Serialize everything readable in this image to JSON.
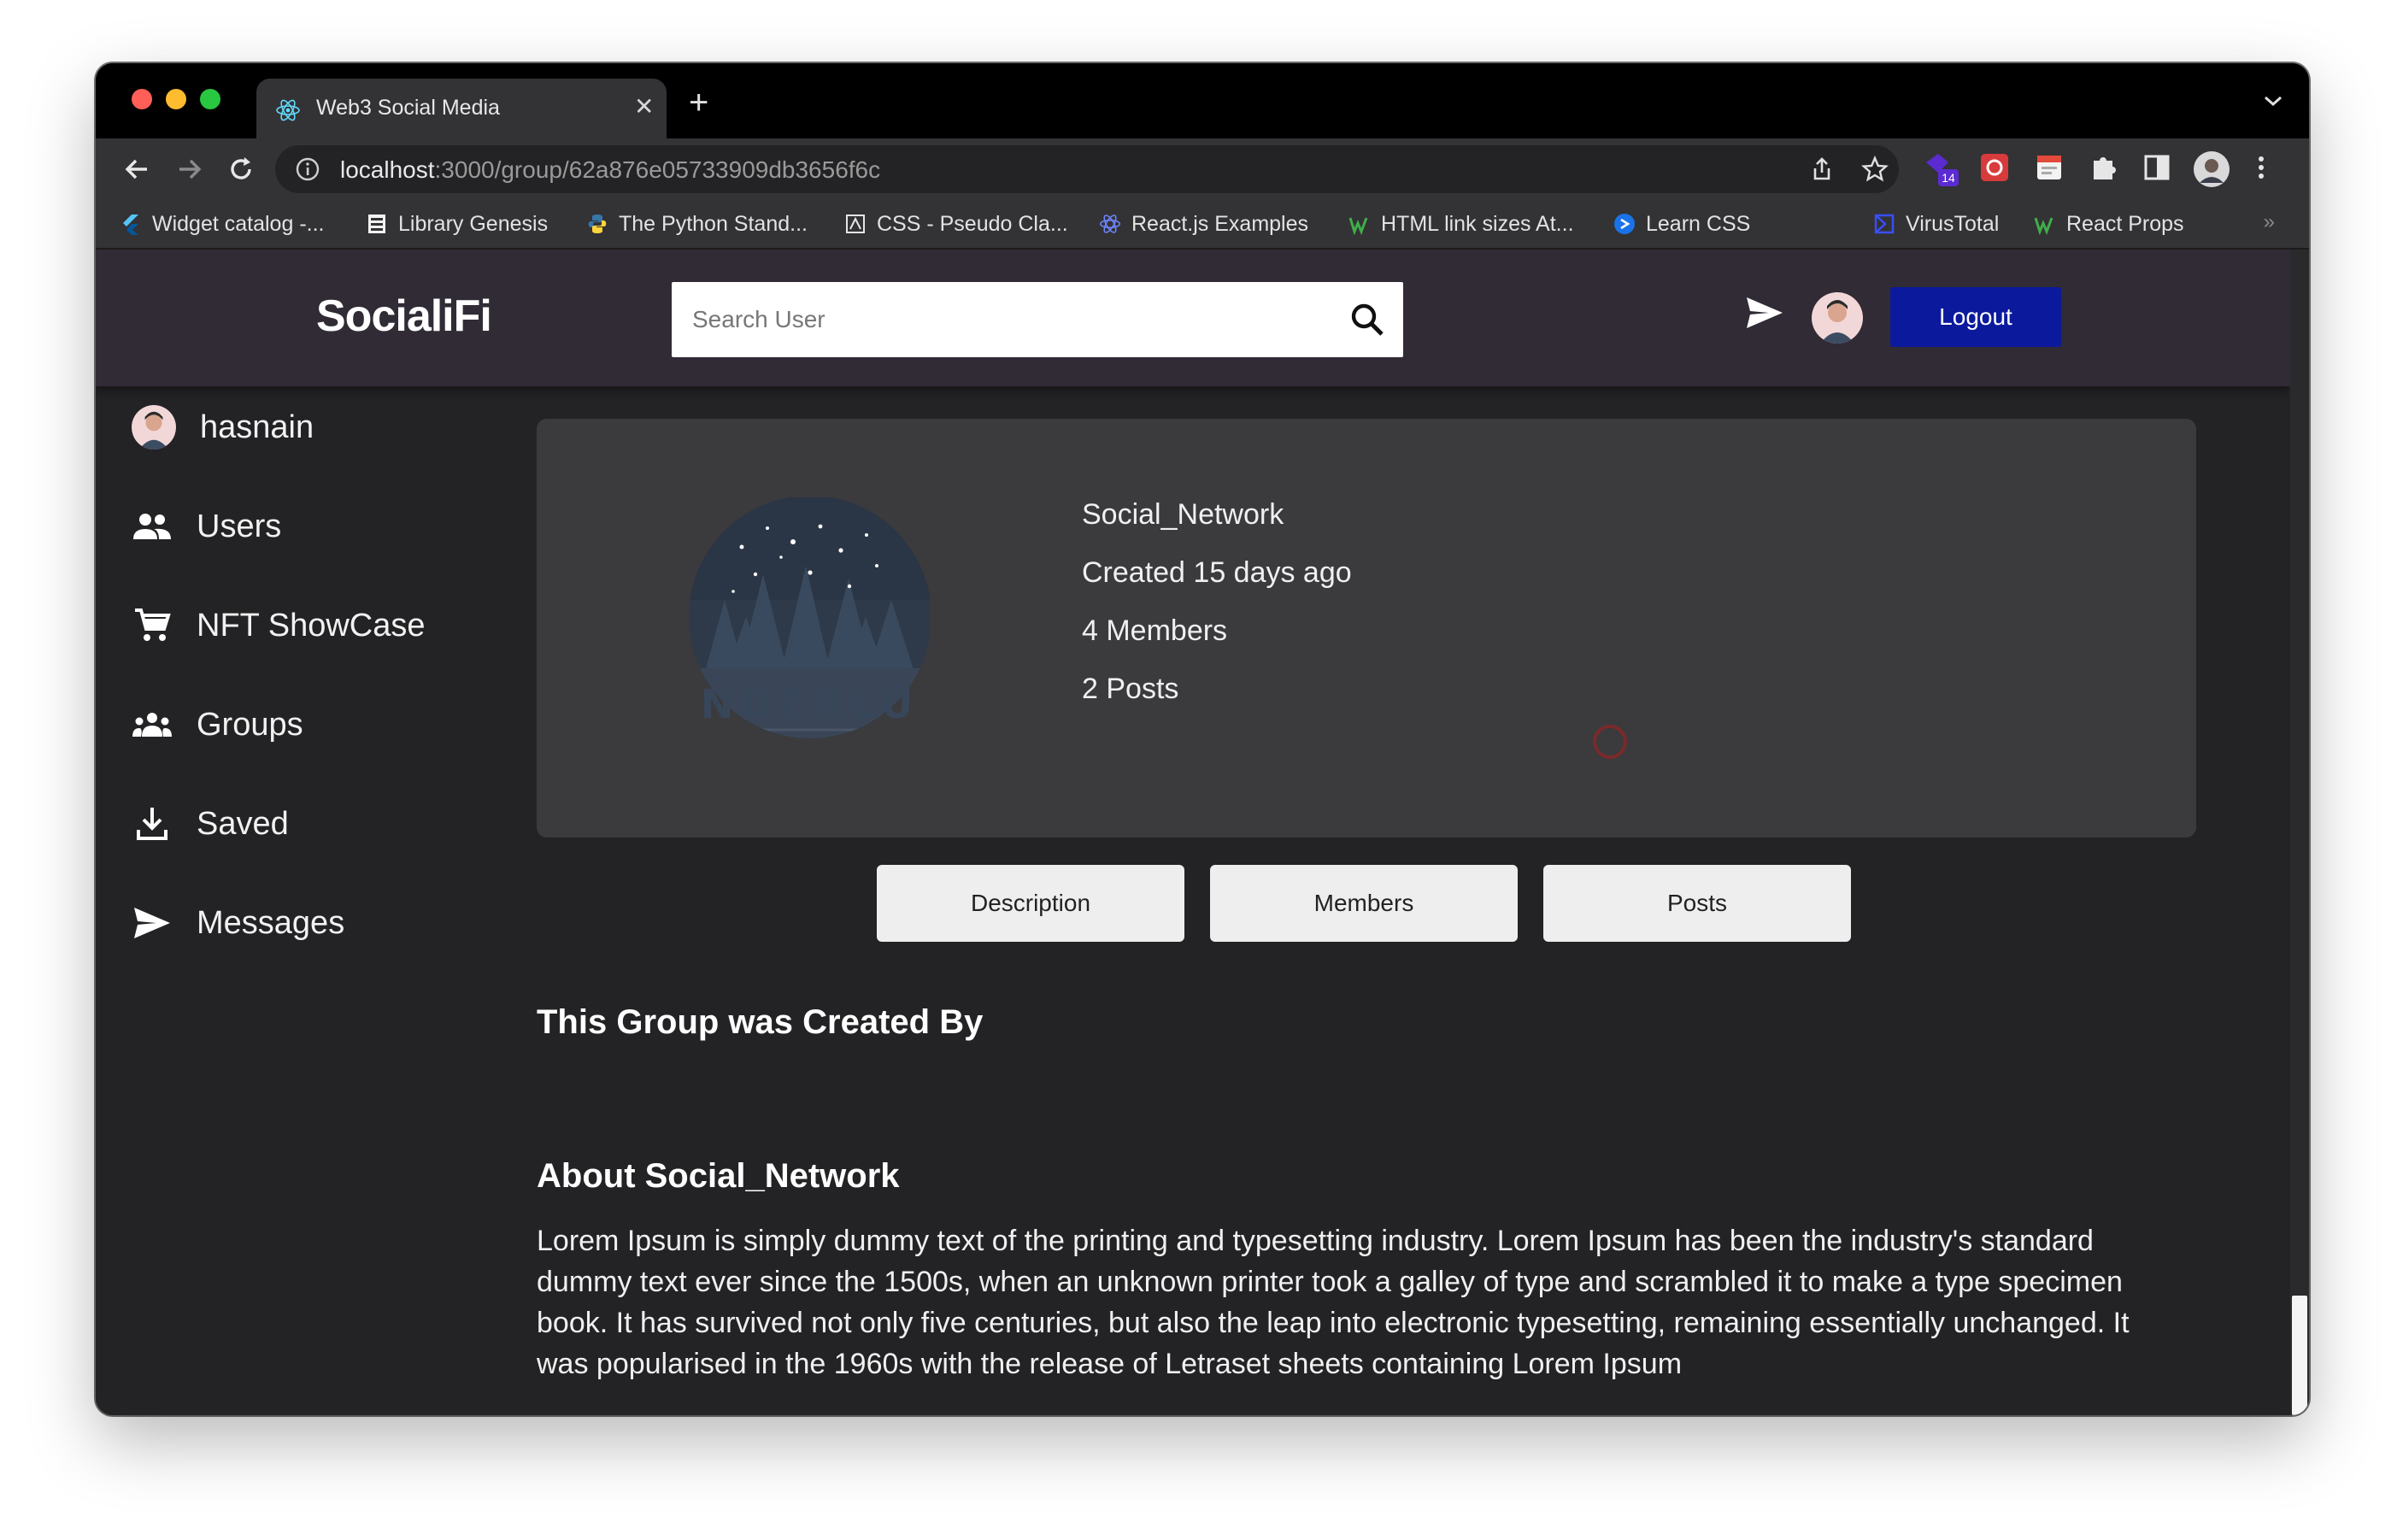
{
  "browser": {
    "tab_title": "Web3 Social Media",
    "url_host": "localhost",
    "url_rest": ":3000/group/62a876e05733909db3656f6c",
    "extension_badge": "14",
    "bookmarks": [
      {
        "label": "Widget catalog -...",
        "icon": "flutter-icon"
      },
      {
        "label": "Library Genesis",
        "icon": "library-icon"
      },
      {
        "label": "The Python Stand...",
        "icon": "python-icon"
      },
      {
        "label": "CSS - Pseudo Cla...",
        "icon": "css-icon"
      },
      {
        "label": "React.js Examples",
        "icon": "react-icon"
      },
      {
        "label": "HTML link sizes At...",
        "icon": "w-icon"
      },
      {
        "label": "Learn CSS",
        "icon": "learn-css-icon"
      },
      {
        "label": "VirusTotal",
        "icon": "virustotal-icon"
      },
      {
        "label": "React Props",
        "icon": "w-icon"
      }
    ],
    "bookmarks_more": "»"
  },
  "app": {
    "brand": "SocialiFi",
    "search_placeholder": "Search User",
    "logout_label": "Logout",
    "accent_color": "#0b1a9c"
  },
  "sidebar": {
    "user": "hasnain",
    "items": [
      {
        "label": "Users",
        "icon": "people-icon"
      },
      {
        "label": "NFT ShowCase",
        "icon": "cart-icon"
      },
      {
        "label": "Groups",
        "icon": "groups-icon"
      },
      {
        "label": "Saved",
        "icon": "download-icon"
      },
      {
        "label": "Messages",
        "icon": "send-icon"
      }
    ]
  },
  "group": {
    "image_text": "NDERLU",
    "name": "Social_Network",
    "created": "Created 15 days ago",
    "members": "4 Members",
    "posts": "2 Posts"
  },
  "tabs": [
    "Description",
    "Members",
    "Posts"
  ],
  "content": {
    "created_by_heading": "This Group was Created By",
    "about_heading": "About Social_Network",
    "description": "Lorem Ipsum is simply dummy text of the printing and typesetting industry. Lorem Ipsum has been the industry's standard dummy text ever since the 1500s, when an unknown printer took a galley of type and scrambled it to make a type specimen book. It has survived not only five centuries, but also the leap into electronic typesetting, remaining essentially unchanged. It was popularised in the 1960s with the release of Letraset sheets containing Lorem Ipsum"
  }
}
